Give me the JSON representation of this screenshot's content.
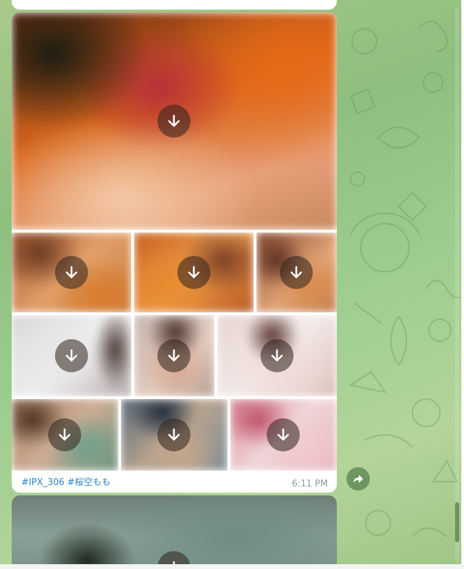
{
  "message": {
    "caption_tags": [
      "#IPX_306",
      "#桜空もも"
    ],
    "time": "6:11 PM"
  },
  "icons": {
    "download": "download-arrow-icon",
    "forward": "forward-arrow-icon"
  },
  "colors": {
    "link": "#2a86c8",
    "timestamp": "#8c9aa3",
    "download_overlay": "rgba(45,35,30,0.55)"
  }
}
